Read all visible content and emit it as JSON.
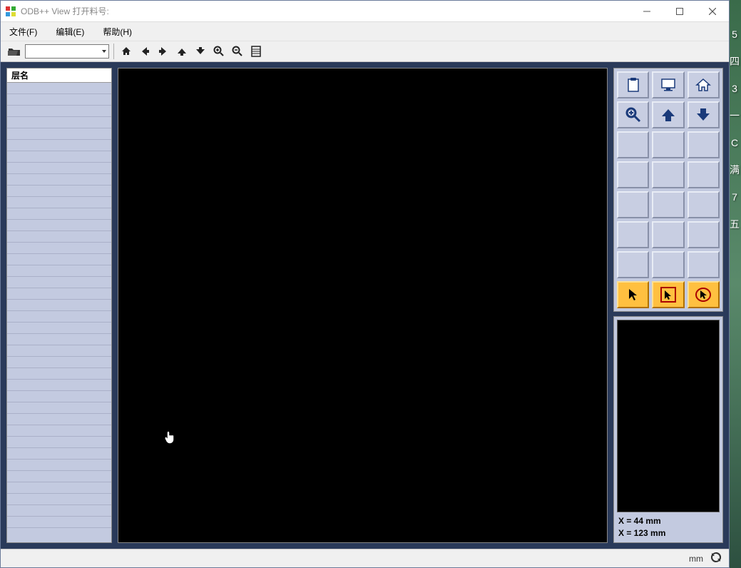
{
  "titlebar": {
    "title": "ODB++ View 打开料号:"
  },
  "menubar": {
    "file": "文件(F)",
    "edit": "编辑(E)",
    "help": "帮助(H)"
  },
  "layer_panel": {
    "header": "层名"
  },
  "coords": {
    "x_label": "X = 44 mm",
    "y_label": "X = 123 mm"
  },
  "statusbar": {
    "unit": "mm"
  },
  "desktop": {
    "frag1": "四",
    "frag2": "一",
    "frag3": "满",
    "frag4": "五"
  }
}
